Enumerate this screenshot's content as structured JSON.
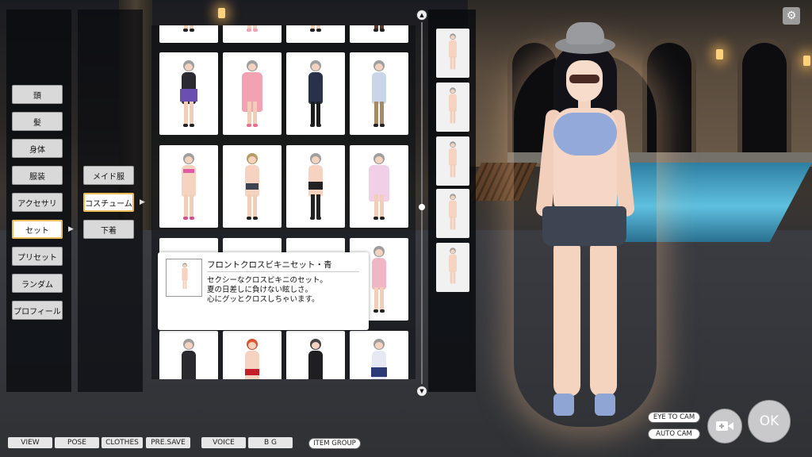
{
  "category_menu": [
    "頭",
    "髪",
    "身体",
    "服装",
    "アクセサリ",
    "セット",
    "プリセット",
    "ランダム",
    "プロフィール"
  ],
  "selected_category": "セット",
  "sub_menu": [
    "メイド服",
    "コスチューム",
    "下着"
  ],
  "selected_sub": "コスチューム",
  "tooltip": {
    "title": "フロントクロスビキニセット・青",
    "line1": "セクシーなクロスビキニのセット。",
    "line2": "夏の日差しに負けない眩しさ。",
    "line3": "心にグッとクロスしちゃいます。"
  },
  "bottom_bar": {
    "view": "VIEW",
    "pose": "POSE",
    "clothes": "CLOTHES",
    "pre_save": "PRE.SAVE",
    "voice": "VOICE",
    "bg": "B G",
    "item_group": "ITEM GROUP"
  },
  "camera": {
    "eye_to_cam": "EYE TO CAM",
    "auto_cam": "AUTO CAM"
  },
  "ok_label": "OK",
  "colors": {
    "selected_border": "#ecbe5a",
    "bikini": "#93a9da",
    "panel": "#080a0e"
  },
  "icons": {
    "settings": "gear-icon",
    "camera": "camera-icon",
    "scroll_up": "arrow-up-icon",
    "scroll_down": "arrow-down-icon"
  }
}
